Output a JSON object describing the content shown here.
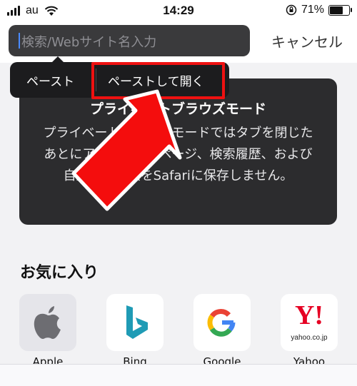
{
  "status": {
    "carrier": "au",
    "time": "14:29",
    "battery_percent": "71%",
    "battery_level": 0.71
  },
  "search": {
    "placeholder": "検索/Webサイト名入力"
  },
  "cancel_label": "キャンセル",
  "context_menu": {
    "paste": "ペースト",
    "paste_and_go": "ペーストして開く"
  },
  "private_card": {
    "title": "プライベートブラウズモード",
    "body": "プライベートブラウズモードではタブを閉じたあとにアクセスしたページ、検索履歴、および自動入力情報をSafariに保存しません。"
  },
  "favorites": {
    "title": "お気に入り",
    "items": [
      {
        "label": "Apple",
        "icon": "apple-icon"
      },
      {
        "label": "Bing",
        "icon": "bing-icon"
      },
      {
        "label": "Google",
        "icon": "google-icon"
      },
      {
        "label": "Yahoo",
        "icon": "yahoo-icon",
        "logo_text": "Y!",
        "domain": "yahoo.co.jp"
      }
    ]
  },
  "colors": {
    "highlight": "#ee1111",
    "menu_bg": "#1c1c1e",
    "card_bg": "#2c2c2e"
  }
}
